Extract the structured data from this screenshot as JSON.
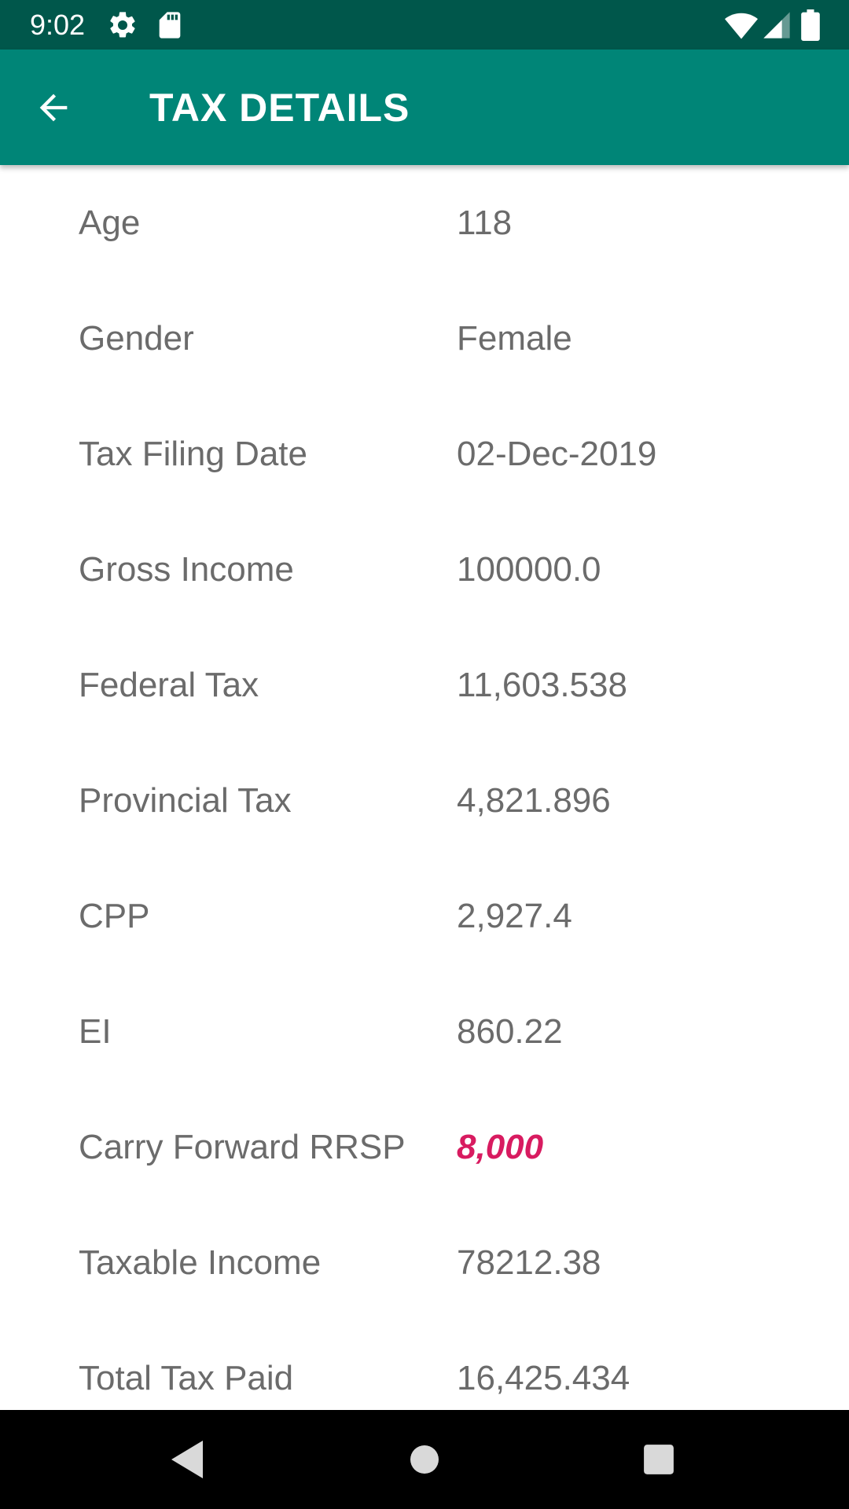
{
  "status_bar": {
    "time": "9:02",
    "icons": [
      "settings-icon",
      "sd-card-icon",
      "wifi-icon",
      "cell-signal-icon",
      "battery-icon"
    ]
  },
  "app_bar": {
    "title": "TAX DETAILS",
    "back_icon": "arrow-back-icon",
    "color": "#008577"
  },
  "details": {
    "rows": [
      {
        "label": "Age",
        "value": "118"
      },
      {
        "label": "Gender",
        "value": "Female"
      },
      {
        "label": "Tax Filing Date",
        "value": "02-Dec-2019"
      },
      {
        "label": "Gross Income",
        "value": "100000.0"
      },
      {
        "label": "Federal Tax",
        "value": "11,603.538"
      },
      {
        "label": "Provincial Tax",
        "value": "4,821.896"
      },
      {
        "label": "CPP",
        "value": "2,927.4"
      },
      {
        "label": "EI",
        "value": "860.22"
      },
      {
        "label": "Carry Forward RRSP",
        "value": "8,000"
      },
      {
        "label": "Taxable Income",
        "value": "78212.38"
      },
      {
        "label": "Total Tax Paid",
        "value": "16,425.434"
      }
    ]
  },
  "colors": {
    "status_bar": "#00574B",
    "accent": "#D81B60",
    "text": "#6b6b6b"
  },
  "nav_bar": {
    "icons": [
      "nav-back-icon",
      "nav-home-icon",
      "nav-recents-icon"
    ]
  }
}
